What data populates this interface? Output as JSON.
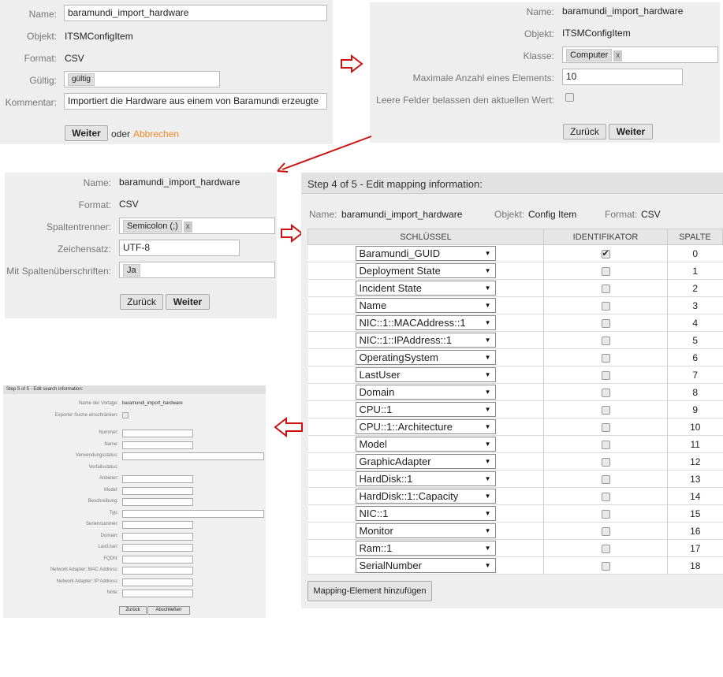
{
  "step1": {
    "labels": {
      "name": "Name:",
      "objekt": "Objekt:",
      "format": "Format:",
      "gueltig": "Gültig:",
      "kommentar": "Kommentar:"
    },
    "name_value": "baramundi_import_hardware",
    "objekt_value": "ITSMConfigItem",
    "format_value": "CSV",
    "gueltig_tag": "gültig",
    "kommentar_value": "Importiert die Hardware aus einem von Baramundi erzeugte",
    "weiter": "Weiter",
    "oder": "oder",
    "abbrechen": "Abbrechen"
  },
  "step2": {
    "labels": {
      "name": "Name:",
      "objekt": "Objekt:",
      "klasse": "Klasse:",
      "max": "Maximale Anzahl eines Elements:",
      "leere": "Leere Felder belassen den aktuellen Wert:"
    },
    "name_value": "baramundi_import_hardware",
    "objekt_value": "ITSMConfigItem",
    "klasse_tag": "Computer",
    "tag_x": "x",
    "max_value": "10",
    "zurueck": "Zurück",
    "weiter": "Weiter"
  },
  "step3": {
    "labels": {
      "name": "Name:",
      "format": "Format:",
      "spaltentrenner": "Spaltentrenner:",
      "zeichensatz": "Zeichensatz:",
      "ueberschriften": "Mit Spaltenüberschriften:"
    },
    "name_value": "baramundi_import_hardware",
    "format_value": "CSV",
    "trenner_tag": "Semicolon (;)",
    "tag_x": "x",
    "zeichensatz_value": "UTF-8",
    "ueberschriften_tag": "Ja",
    "zurueck": "Zurück",
    "weiter": "Weiter"
  },
  "step4": {
    "header": "Step 4 of 5 - Edit mapping information:",
    "name_label": "Name:",
    "name_value": "baramundi_import_hardware",
    "objekt_label": "Objekt:",
    "objekt_value": "Config Item",
    "format_label": "Format:",
    "format_value": "CSV",
    "columns": [
      "SCHLÜSSEL",
      "IDENTIFIKATOR",
      "SPALTE"
    ],
    "rows": [
      {
        "key": "Baramundi_GUID",
        "id": true,
        "col": "0"
      },
      {
        "key": "Deployment State",
        "id": false,
        "col": "1"
      },
      {
        "key": "Incident State",
        "id": false,
        "col": "2"
      },
      {
        "key": "Name",
        "id": false,
        "col": "3"
      },
      {
        "key": "NIC::1::MACAddress::1",
        "id": false,
        "col": "4"
      },
      {
        "key": "NIC::1::IPAddress::1",
        "id": false,
        "col": "5"
      },
      {
        "key": "OperatingSystem",
        "id": false,
        "col": "6"
      },
      {
        "key": "LastUser",
        "id": false,
        "col": "7"
      },
      {
        "key": "Domain",
        "id": false,
        "col": "8"
      },
      {
        "key": "CPU::1",
        "id": false,
        "col": "9"
      },
      {
        "key": "CPU::1::Architecture",
        "id": false,
        "col": "10"
      },
      {
        "key": "Model",
        "id": false,
        "col": "11"
      },
      {
        "key": "GraphicAdapter",
        "id": false,
        "col": "12"
      },
      {
        "key": "HardDisk::1",
        "id": false,
        "col": "13"
      },
      {
        "key": "HardDisk::1::Capacity",
        "id": false,
        "col": "14"
      },
      {
        "key": "NIC::1",
        "id": false,
        "col": "15"
      },
      {
        "key": "Monitor",
        "id": false,
        "col": "16"
      },
      {
        "key": "Ram::1",
        "id": false,
        "col": "17"
      },
      {
        "key": "SerialNumber",
        "id": false,
        "col": "18"
      }
    ],
    "add_button": "Mapping-Element hinzufügen"
  },
  "step5": {
    "header": "Step 5 of 5 - Edit search information:",
    "vorlage_label": "Name der Vorlage:",
    "vorlage_value": "baramundi_import_hardware",
    "exporter_label": "Exporter Suche einschränken:",
    "fields": [
      "Nummer:",
      "Name:",
      "Verwendungsstatus:",
      "Vorfallsstatus:",
      "Anbieter:",
      "Model:",
      "Beschreibung:",
      "Typ:",
      "Seriennummer:",
      "Domain:",
      "LastUser:",
      "FQDN:",
      "Network Adapter::MAC Address:",
      "Network Adapter::IP Address:",
      "Note:"
    ],
    "zurueck": "Zurück",
    "abschliessen": "Abschließen"
  },
  "colors": {
    "panel": "#eeeeee",
    "arrow": "#cc1111",
    "link": "#f08a24"
  }
}
